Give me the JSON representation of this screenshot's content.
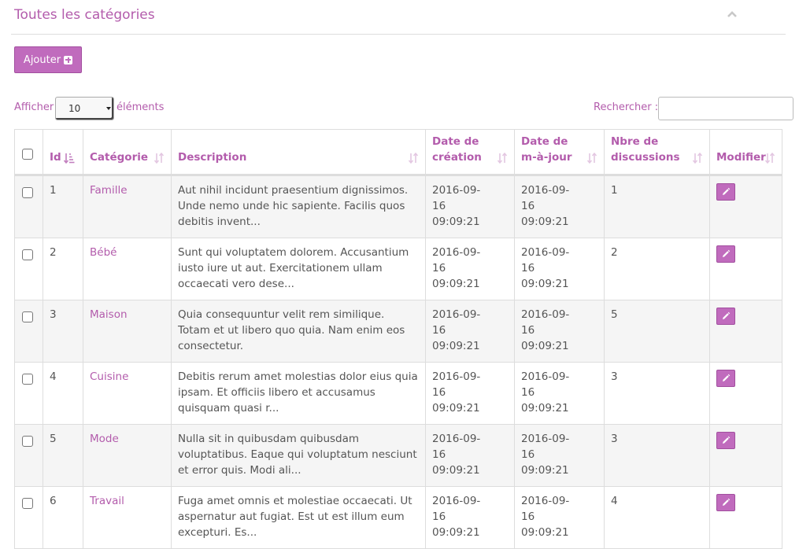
{
  "panel": {
    "title": "Toutes les catégories",
    "collapse_icon": "chevron-up-icon"
  },
  "toolbar": {
    "add_label": "Ajouter",
    "add_icon": "plus-square-icon"
  },
  "length_menu": {
    "prefix": "Afficher",
    "value": "10",
    "suffix": "éléments"
  },
  "search": {
    "label": "Rechercher :",
    "value": ""
  },
  "colors": {
    "accent": "#b35cac",
    "button": "#c06bbd",
    "text": "#555555",
    "row_stripe": "#f5f5f5",
    "border": "#dddddd"
  },
  "table": {
    "columns": [
      {
        "key": "id",
        "label": "Id",
        "sort": "sort-asc-icon"
      },
      {
        "key": "category",
        "label": "Catégorie",
        "sort": "sort-icon"
      },
      {
        "key": "description",
        "label": "Description",
        "sort": "sort-icon"
      },
      {
        "key": "created",
        "label": "Date de création",
        "sort": "sort-icon"
      },
      {
        "key": "updated",
        "label": "Date de m-à-jour",
        "sort": "sort-icon"
      },
      {
        "key": "discussions",
        "label": "Nbre de discussions",
        "sort": "sort-icon"
      },
      {
        "key": "edit",
        "label": "Modifier",
        "sort": "sort-icon"
      }
    ],
    "rows": [
      {
        "id": "1",
        "category": "Famille",
        "description": "Aut nihil incidunt praesentium dignissimos. Unde nemo unde hic sapiente. Facilis quos debitis invent...",
        "created": "2016-09-16 09:09:21",
        "updated": "2016-09-16 09:09:21",
        "discussions": "1"
      },
      {
        "id": "2",
        "category": "Bébé",
        "description": "Sunt qui voluptatem dolorem. Accusantium iusto iure ut aut. Exercitationem ullam occaecati vero dese...",
        "created": "2016-09-16 09:09:21",
        "updated": "2016-09-16 09:09:21",
        "discussions": "2"
      },
      {
        "id": "3",
        "category": "Maison",
        "description": "Quia consequuntur velit rem similique. Totam et ut libero quo quia. Nam enim eos consectetur.",
        "created": "2016-09-16 09:09:21",
        "updated": "2016-09-16 09:09:21",
        "discussions": "5"
      },
      {
        "id": "4",
        "category": "Cuisine",
        "description": "Debitis rerum amet molestias dolor eius quia ipsam. Et officiis libero et accusamus quisquam quasi r...",
        "created": "2016-09-16 09:09:21",
        "updated": "2016-09-16 09:09:21",
        "discussions": "3"
      },
      {
        "id": "5",
        "category": "Mode",
        "description": "Nulla sit in quibusdam quibusdam voluptatibus. Eaque qui voluptatum nesciunt et error quis. Modi ali...",
        "created": "2016-09-16 09:09:21",
        "updated": "2016-09-16 09:09:21",
        "discussions": "3"
      },
      {
        "id": "6",
        "category": "Travail",
        "description": "Fuga amet omnis et molestiae occaecati. Ut aspernatur aut fugiat. Est ut est illum eum excepturi. Es...",
        "created": "2016-09-16 09:09:21",
        "updated": "2016-09-16 09:09:21",
        "discussions": "4"
      }
    ],
    "edit_icon": "pencil-icon"
  }
}
